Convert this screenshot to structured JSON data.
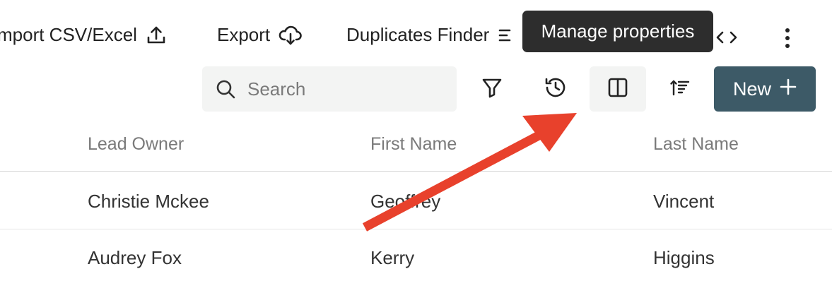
{
  "toolbar": {
    "import_label": "mport CSV/Excel",
    "export_label": "Export",
    "duplicates_label": "Duplicates Finder",
    "more_icon": "vertical-dots-icon",
    "code_icon": "code-brackets-icon"
  },
  "tooltip": {
    "text": "Manage properties"
  },
  "search": {
    "placeholder": "Search"
  },
  "actions": {
    "filter_icon": "filter-icon",
    "history_icon": "history-icon",
    "columns_icon": "columns-icon",
    "sort_icon": "sort-icon",
    "new_label": "New"
  },
  "table": {
    "columns": [
      "Lead Owner",
      "First Name",
      "Last Name"
    ],
    "rows": [
      [
        "Christie Mckee",
        "Geoffrey",
        "Vincent"
      ],
      [
        "Audrey Fox",
        "Kerry",
        "Higgins"
      ]
    ]
  },
  "colors": {
    "primary_button": "#3d5a67",
    "tooltip_bg": "#2d2d2d",
    "annotation_arrow": "#e8412c"
  }
}
